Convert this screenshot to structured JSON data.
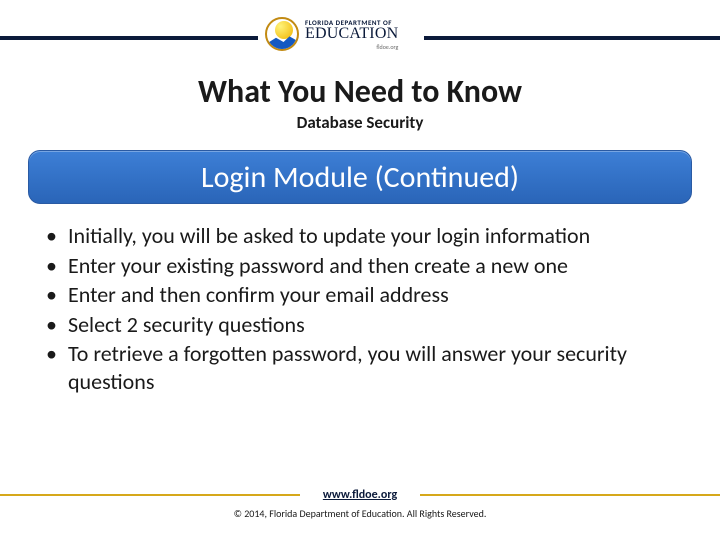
{
  "logo": {
    "dept": "FLORIDA DEPARTMENT OF",
    "edu": "EDUCATION",
    "url": "fldoe.org"
  },
  "title": "What You Need to Know",
  "subtitle": "Database Security",
  "section_heading": "Login Module (Continued)",
  "bullets": [
    "Initially, you will be asked to update your login information",
    "Enter your existing password and then create a new one",
    "Enter and then confirm your email address",
    "Select 2 security questions",
    "To retrieve a forgotten password, you will answer your security questions"
  ],
  "footer": {
    "link": "www.fldoe.org",
    "copyright": "© 2014, Florida Department of Education. All Rights Reserved."
  }
}
